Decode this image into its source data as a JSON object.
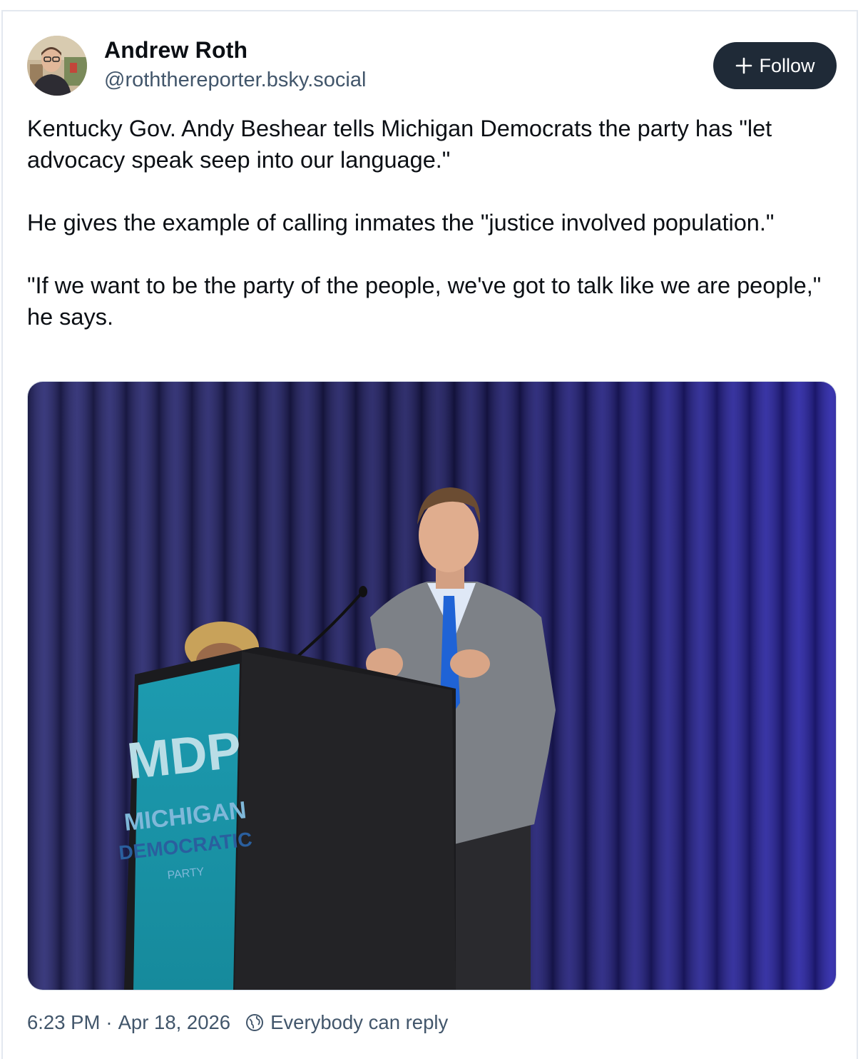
{
  "author": {
    "name": "Andrew Roth",
    "handle": "@roththereporter.bsky.social"
  },
  "follow_button": {
    "label": "Follow",
    "icon": "plus-icon"
  },
  "post": {
    "paragraphs": [
      "Kentucky Gov. Andy Beshear tells Michigan Democrats the party has \"let advocacy speak seep into our language.\"",
      "He gives the example of calling inmates the \"justice involved population.\"",
      "\"If we want to be the party of the people, we've got to talk like we are people,\" he says."
    ],
    "image": {
      "podium_sign": {
        "logo": "MDP",
        "line1": "MICHIGAN",
        "line2": "DEMOCRATIC",
        "line3": "PARTY"
      }
    }
  },
  "meta": {
    "time": "6:23 PM",
    "separator": "·",
    "date": "Apr 18, 2026",
    "reply_setting": "Everybody can reply",
    "reply_icon": "globe-reply-icon"
  },
  "colors": {
    "follow_bg": "#1f2a37",
    "muted_text": "#42566b",
    "border": "#e3e8ef"
  }
}
